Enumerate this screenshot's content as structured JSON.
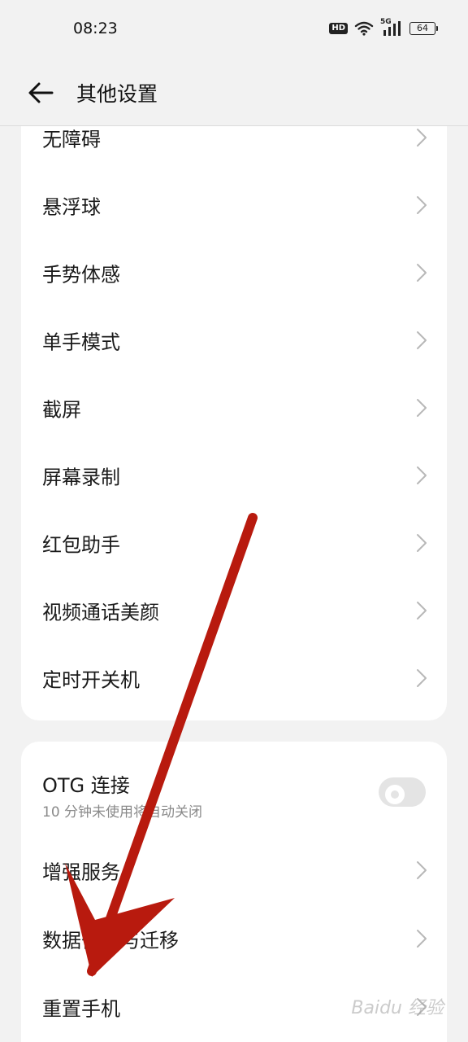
{
  "status_bar": {
    "time": "08:23",
    "hd": "HD",
    "network": "5G",
    "battery": "64"
  },
  "header": {
    "title": "其他设置"
  },
  "group1": [
    {
      "label": "无障碍"
    },
    {
      "label": "悬浮球"
    },
    {
      "label": "手势体感"
    },
    {
      "label": "单手模式"
    },
    {
      "label": "截屏"
    },
    {
      "label": "屏幕录制"
    },
    {
      "label": "红包助手"
    },
    {
      "label": "视频通话美颜"
    },
    {
      "label": "定时开关机"
    }
  ],
  "group2": {
    "otg": {
      "label": "OTG 连接",
      "sub": "10 分钟未使用将自动关闭",
      "enabled": false
    },
    "items": [
      {
        "label": "增强服务"
      },
      {
        "label": "数据备份与迁移"
      },
      {
        "label": "重置手机"
      }
    ]
  },
  "watermark": "Baidu 经验",
  "colors": {
    "background": "#f2f2f2",
    "card": "#ffffff",
    "arrow": "#c0180c"
  }
}
